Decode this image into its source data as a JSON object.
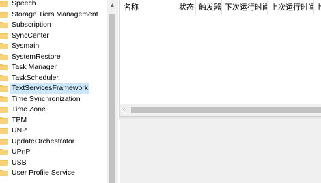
{
  "tree": {
    "items": [
      {
        "label": "Speech"
      },
      {
        "label": "Storage Tiers Management"
      },
      {
        "label": "Subscription"
      },
      {
        "label": "SyncCenter"
      },
      {
        "label": "Sysmain"
      },
      {
        "label": "SystemRestore"
      },
      {
        "label": "Task Manager"
      },
      {
        "label": "TaskScheduler"
      },
      {
        "label": "TextServicesFramework",
        "selected": true
      },
      {
        "label": "Time Synchronization"
      },
      {
        "label": "Time Zone"
      },
      {
        "label": "TPM"
      },
      {
        "label": "UNP"
      },
      {
        "label": "UpdateOrchestrator"
      },
      {
        "label": "UPnP"
      },
      {
        "label": "USB"
      },
      {
        "label": "User Profile Service"
      }
    ]
  },
  "task_list": {
    "columns": [
      {
        "label": "名称"
      },
      {
        "label": "状态"
      },
      {
        "label": "触发器"
      },
      {
        "label": "下次运行时间"
      },
      {
        "label": "上次运行时间"
      },
      {
        "label": "上"
      }
    ]
  },
  "colors": {
    "selection": "#cce8ff",
    "folder": "#f2c55c"
  }
}
